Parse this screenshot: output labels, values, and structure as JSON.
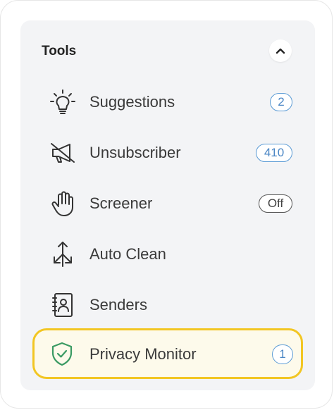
{
  "tools": {
    "title": "Tools",
    "items": [
      {
        "label": "Suggestions",
        "icon": "lightbulb-icon",
        "badge": "2",
        "badge_type": "count"
      },
      {
        "label": "Unsubscriber",
        "icon": "muted-megaphone-icon",
        "badge": "410",
        "badge_type": "count"
      },
      {
        "label": "Screener",
        "icon": "hand-icon",
        "badge": "Off",
        "badge_type": "off"
      },
      {
        "label": "Auto Clean",
        "icon": "auto-clean-arrows-icon"
      },
      {
        "label": "Senders",
        "icon": "contact-book-icon"
      },
      {
        "label": "Privacy Monitor",
        "icon": "shield-check-icon",
        "badge": "1",
        "badge_type": "count",
        "highlighted": true
      }
    ]
  },
  "colors": {
    "panel_bg": "#f3f4f6",
    "badge_blue": "#5b9bd5",
    "highlight_border": "#f2c623",
    "highlight_bg": "#fdfaeb",
    "shield_green": "#3a9a63"
  }
}
